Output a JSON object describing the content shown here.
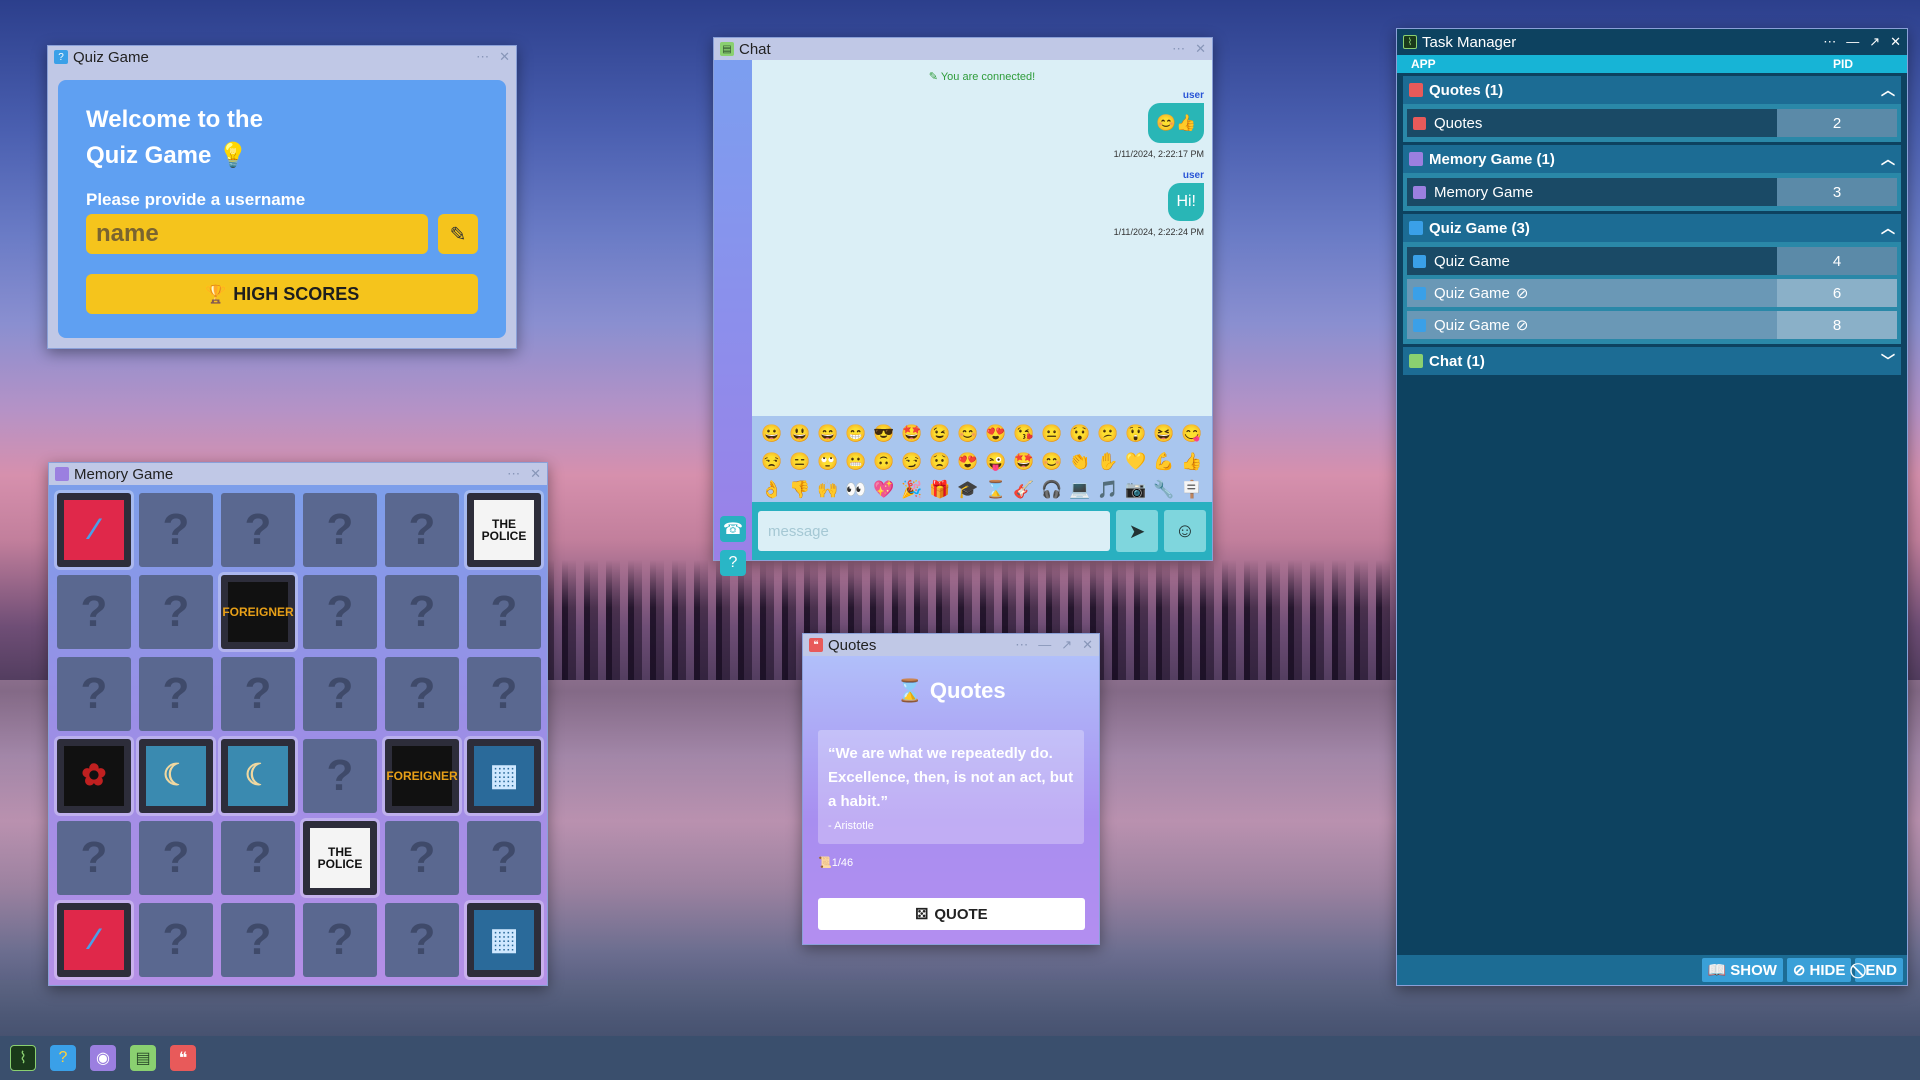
{
  "quiz": {
    "title": "Quiz Game",
    "welcome_line1": "Welcome to the",
    "welcome_line2": "Quiz Game 💡",
    "prompt": "Please provide a username",
    "input_placeholder": "name",
    "highscores": "HIGH SCORES"
  },
  "memory": {
    "title": "Memory Game",
    "unknown": "?",
    "cards": [
      "album-red",
      "?",
      "?",
      "?",
      "?",
      "THE POLICE",
      "?",
      "?",
      "FOREIGNER",
      "?",
      "?",
      "?",
      "?",
      "?",
      "?",
      "?",
      "?",
      "?",
      "album-rose",
      "album-moon",
      "album-moon",
      "?",
      "FOREIGNER",
      "album-city",
      "?",
      "?",
      "?",
      "THE POLICE",
      "?",
      "?",
      "album-red",
      "?",
      "?",
      "?",
      "?",
      "album-city"
    ]
  },
  "chat": {
    "title": "Chat",
    "connected": "You are connected!",
    "messages": [
      {
        "user": "user",
        "text": "😊👍",
        "time": "1/11/2024, 2:22:17 PM"
      },
      {
        "user": "user",
        "text": "Hi!",
        "time": "1/11/2024, 2:22:24 PM"
      }
    ],
    "placeholder": "message",
    "emojis": [
      "😀",
      "😃",
      "😄",
      "😁",
      "😎",
      "🤩",
      "😉",
      "😊",
      "😍",
      "😘",
      "😐",
      "😯",
      "😕",
      "😲",
      "😆",
      "😋",
      "😒",
      "😑",
      "🙄",
      "😬",
      "🙃",
      "😏",
      "😟",
      "😍",
      "😜",
      "🤩",
      "😊",
      "👏",
      "✋",
      "💛",
      "💪",
      "👍",
      "👌",
      "👎",
      "🙌",
      "👀",
      "💖",
      "🎉",
      "🎁",
      "🎓",
      "⌛",
      "🎸",
      "🎧",
      "💻",
      "🎵",
      "📷",
      "🔧",
      "🪧"
    ]
  },
  "quotes": {
    "title": "Quotes",
    "heading": "Quotes",
    "text": "“We are what we repeatedly do. Excellence, then, is not an act, but a habit.”",
    "author": "- Aristotle",
    "count": "1/46",
    "button": "QUOTE"
  },
  "taskmanager": {
    "title": "Task Manager",
    "col_app": "APP",
    "col_pid": "PID",
    "groups": [
      {
        "name": "Quotes (1)",
        "chev": "︿",
        "rows": [
          {
            "name": "Quotes",
            "pid": "2",
            "hidden": false
          }
        ]
      },
      {
        "name": "Memory Game (1)",
        "chev": "︿",
        "rows": [
          {
            "name": "Memory Game",
            "pid": "3",
            "hidden": false
          }
        ]
      },
      {
        "name": "Quiz Game (3)",
        "chev": "︿",
        "rows": [
          {
            "name": "Quiz Game",
            "pid": "4",
            "hidden": false
          },
          {
            "name": "Quiz Game",
            "pid": "6",
            "hidden": true
          },
          {
            "name": "Quiz Game",
            "pid": "8",
            "hidden": true
          }
        ]
      },
      {
        "name": "Chat (1)",
        "chev": "﹀",
        "rows": []
      }
    ],
    "show": "SHOW",
    "hide": "HIDE",
    "end": "END"
  },
  "colors": {
    "quotes": "#e85a5a",
    "memory": "#9b7fe0",
    "quiz": "#3aa0e8",
    "chat": "#8ad070"
  }
}
